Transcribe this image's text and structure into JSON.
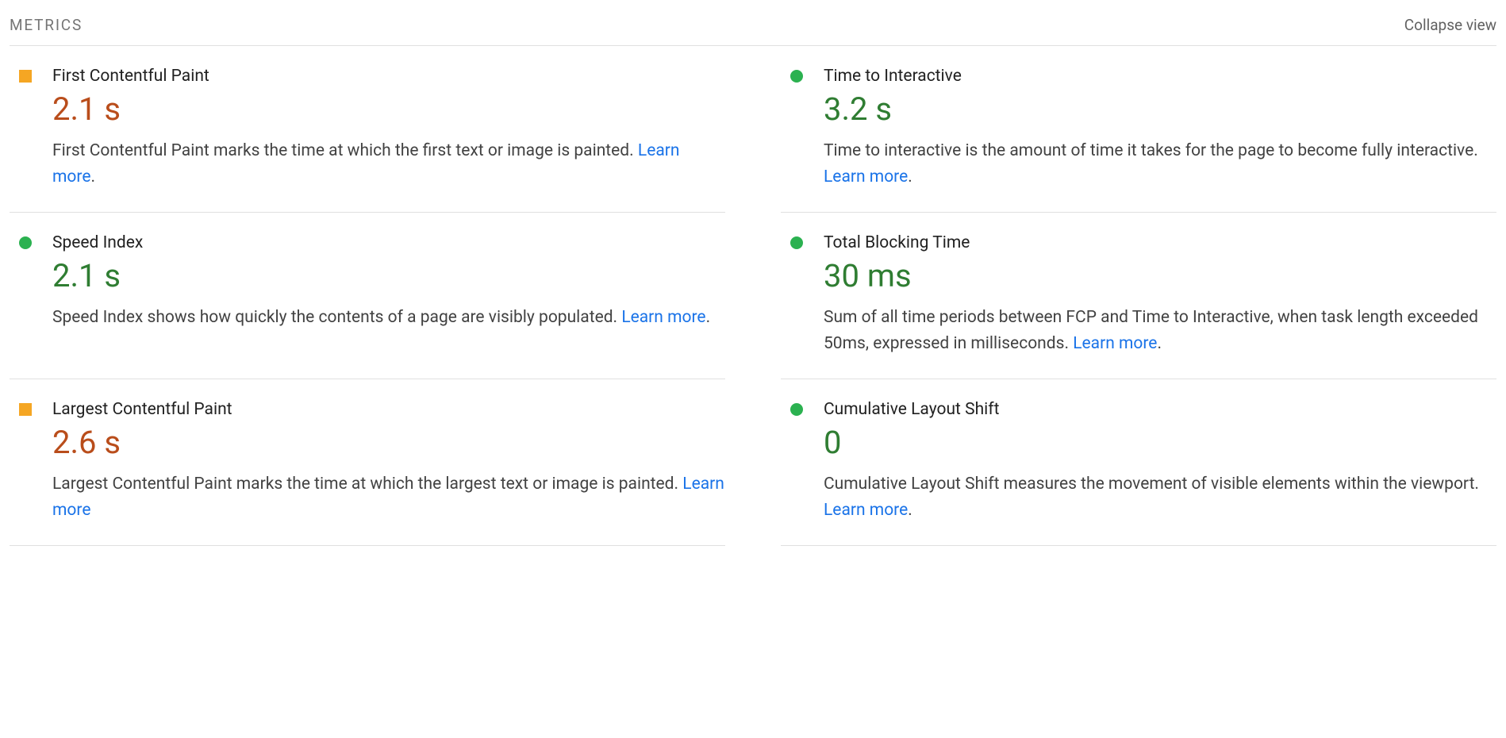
{
  "header": {
    "section_title": "METRICS",
    "collapse_label": "Collapse view"
  },
  "common": {
    "learn_more": "Learn more"
  },
  "metrics": [
    {
      "name": "First Contentful Paint",
      "value": "2.1 s",
      "status": "average",
      "description": "First Contentful Paint marks the time at which the first text or image is painted. ",
      "trailing_period": true
    },
    {
      "name": "Time to Interactive",
      "value": "3.2 s",
      "status": "good",
      "description": "Time to interactive is the amount of time it takes for the page to become fully interactive. ",
      "trailing_period": true
    },
    {
      "name": "Speed Index",
      "value": "2.1 s",
      "status": "good",
      "description": "Speed Index shows how quickly the contents of a page are visibly populated. ",
      "trailing_period": true
    },
    {
      "name": "Total Blocking Time",
      "value": "30 ms",
      "status": "good",
      "description": "Sum of all time periods between FCP and Time to Interactive, when task length exceeded 50ms, expressed in milliseconds. ",
      "trailing_period": true
    },
    {
      "name": "Largest Contentful Paint",
      "value": "2.6 s",
      "status": "average",
      "description": "Largest Contentful Paint marks the time at which the largest text or image is painted. ",
      "trailing_period": false
    },
    {
      "name": "Cumulative Layout Shift",
      "value": "0",
      "status": "good",
      "description": "Cumulative Layout Shift measures the movement of visible elements within the viewport. ",
      "trailing_period": true
    }
  ]
}
